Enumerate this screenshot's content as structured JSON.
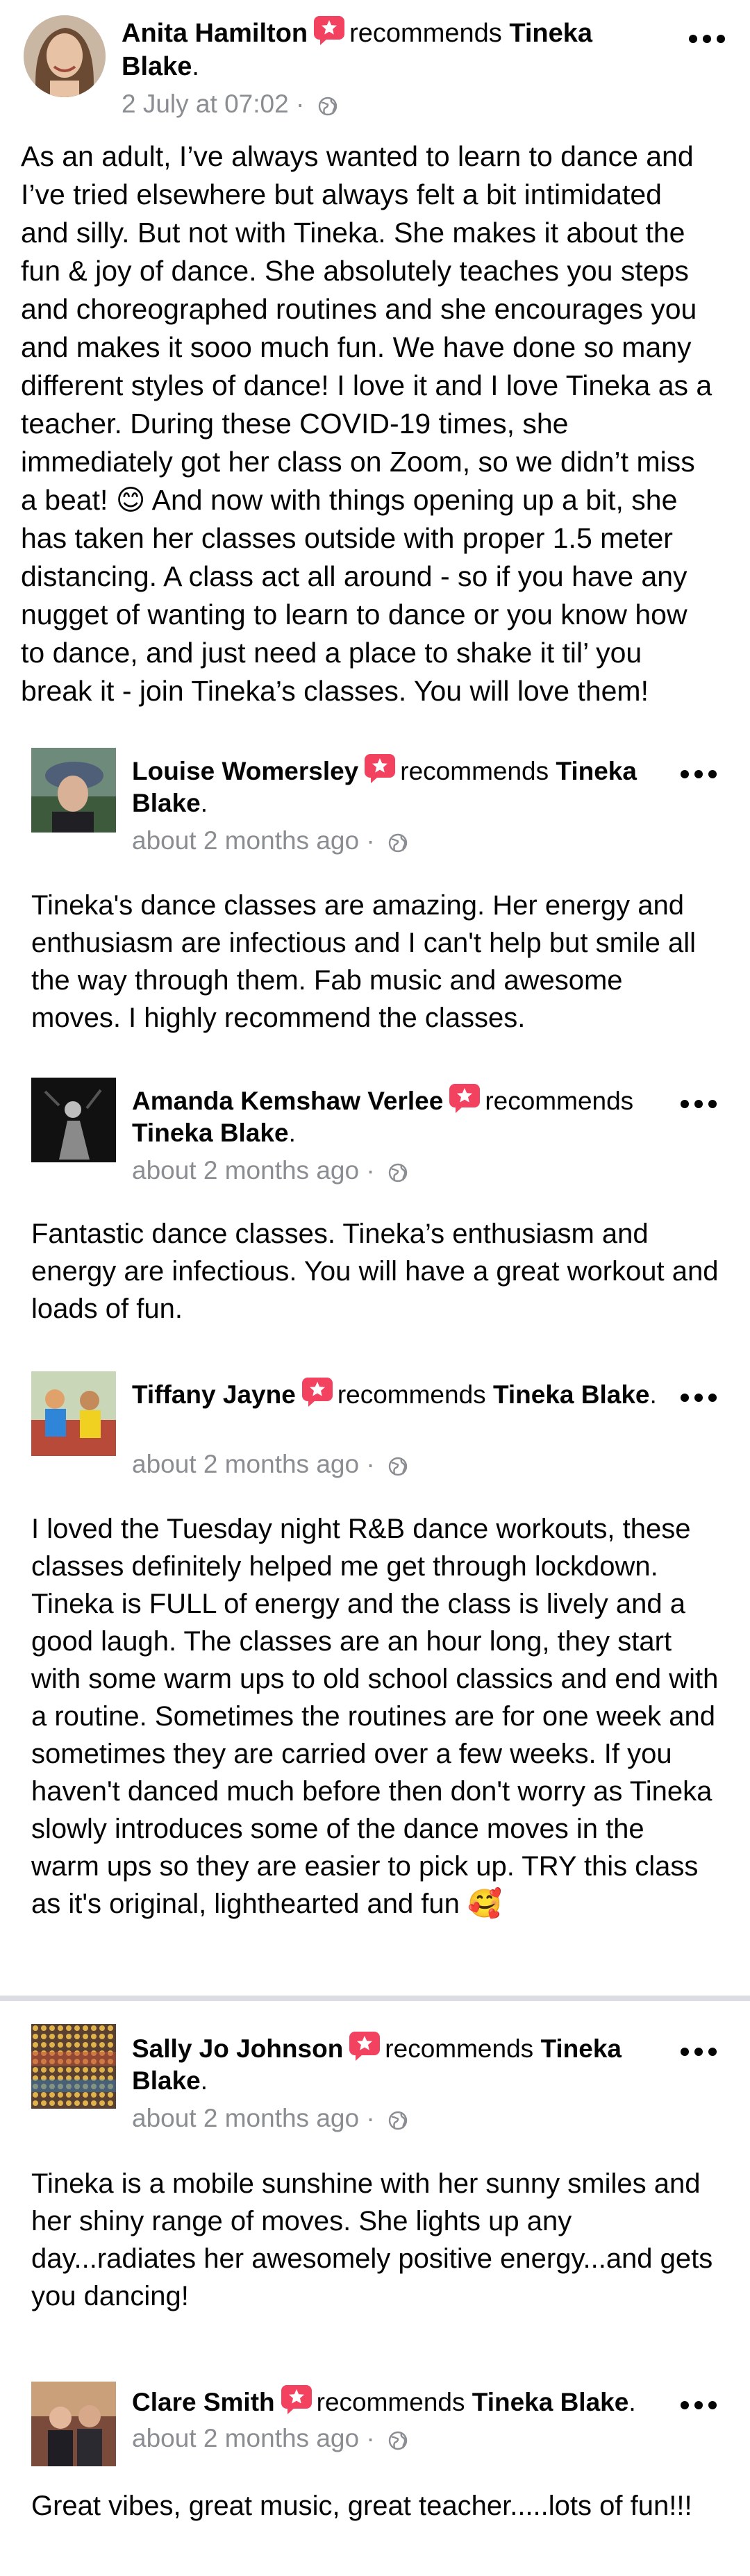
{
  "recommend_word": "recommends",
  "posts": [
    {
      "author": "Anita Hamilton",
      "target": "Tineka Blake",
      "timestamp": "2 July at 07:02",
      "text": "As an adult, I’ve always wanted to learn to dance and I’ve tried elsewhere but always felt a bit intimidated and silly. But not with Tineka. She makes it about the fun & joy of dance. She absolutely teaches you steps and choreographed routines and she encourages you and makes it sooo much fun. We have done so many different styles of dance! I love it and I love Tineka as a teacher. During these COVID-19 times, she immediately got her class on Zoom, so we didn’t miss a beat! 😊 And now with things opening up a bit, she has taken her classes outside with proper 1.5 meter distancing. A class act all around - so if you have any nugget of wanting to learn to dance or you know how to dance, and just need a place to shake it til’ you break it - join Tineka’s classes. You will love them!"
    },
    {
      "author": "Louise Womersley",
      "target": "Tineka Blake",
      "timestamp": "about 2 months ago",
      "text": "Tineka's dance classes are amazing. Her energy and enthusiasm are infectious and I can't help but smile all the way through them. Fab music and awesome moves. I highly recommend the classes."
    },
    {
      "author": "Amanda Kemshaw Verlee",
      "target": "Tineka Blake",
      "timestamp": "about 2 months ago",
      "text": "Fantastic dance classes. Tineka’s enthusiasm and energy are infectious. You will have a great workout and loads of fun."
    },
    {
      "author": "Tiffany Jayne",
      "target": "Tineka Blake",
      "timestamp": "about 2 months ago",
      "text": "I loved the Tuesday night R&B dance workouts, these classes definitely helped me get through lockdown. Tineka is FULL of energy and the class is lively and a good laugh. The classes are an hour long, they start with some warm ups to old school classics and end with a routine. Sometimes the routines are for one week and sometimes they are carried over a few weeks. If you haven't danced much before then don't worry as Tineka slowly introduces some of the dance moves in the warm ups so they are easier to pick up. TRY this class as it's original, lighthearted and fun 🥰"
    },
    {
      "author": "Sally Jo Johnson",
      "target": "Tineka Blake",
      "timestamp": "about 2 months ago",
      "text": "Tineka is a mobile sunshine with her sunny smiles and her shiny range of moves. She lights up any day...radiates her awesomely positive energy...and gets you dancing!"
    },
    {
      "author": "Clare Smith",
      "target": "Tineka Blake",
      "timestamp": "about 2 months ago",
      "text": "Great vibes, great music, great teacher.....lots of fun!!!"
    }
  ],
  "colors": {
    "badge": "#f3425f",
    "meta": "#8a8d91",
    "divider": "#dcdde3"
  }
}
